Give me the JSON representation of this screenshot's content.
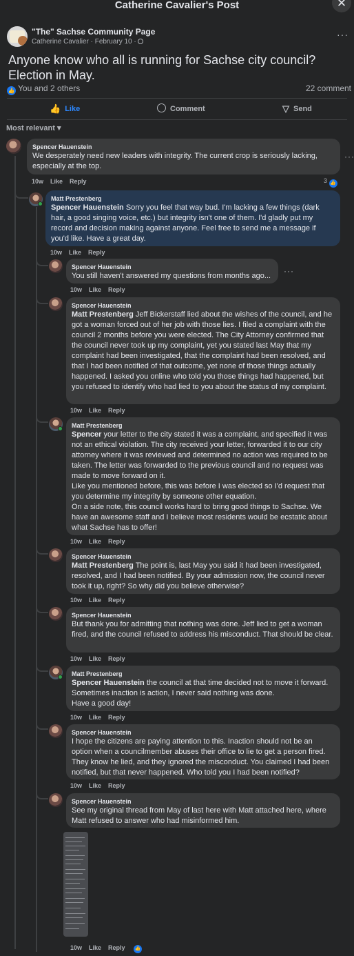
{
  "header": {
    "title": "Catherine Cavalier's Post",
    "close_symbol": "✕"
  },
  "post": {
    "page_name": "\"The\" Sachse Community Page",
    "author_line": "Catherine Cavalier · February 10 ·",
    "text": "Anyone know who all is running for Sachse city council? Election in May.",
    "reactions_text": "You and 2 others",
    "comment_count": "22 comment",
    "more": "···"
  },
  "actions": {
    "like": "Like",
    "comment": "Comment",
    "send": "Send"
  },
  "sort_label": "Most relevant ▾",
  "comments": [
    {
      "author": "Spencer Hauenstein",
      "tag": "",
      "text": "We desperately need new leaders with integrity. The current crop is seriously lacking, especially at the top.",
      "time": "10w",
      "like": "Like",
      "reply": "Reply",
      "reaction_count": "3"
    },
    {
      "author": "Matt Prestenberg",
      "tag": "Spencer Hauenstein",
      "text": " Sorry you feel that way bud. I'm lacking a few things (dark hair, a good singing voice, etc.) but integrity isn't one of them. I'd gladly put my record and decision making against anyone. Feel free to send me a message if you'd like. Have a great day.",
      "time": "10w",
      "like": "Like",
      "reply": "Reply"
    },
    {
      "author": "Spencer Hauenstein",
      "tag": "",
      "text": "You still haven't answered my questions from months ago...",
      "time": "10w",
      "like": "Like",
      "reply": "Reply"
    },
    {
      "author": "Spencer Hauenstein",
      "tag": "Matt Prestenberg",
      "text": " Jeff Bickerstaff lied about the wishes of the council, and he got a woman forced out of her job with those lies. I filed a complaint with the council 2 months before you were elected. The City Attorney confirmed that the council never took up my complaint, yet you stated last May that my complaint had been investigated, that the complaint had been resolved, and that I had been notified of that outcome, yet none of those things actually happened. I asked you online who told you those things had happened, but you refused to identify who had lied to you about the status of my complaint.",
      "time": "10w",
      "like": "Like",
      "reply": "Reply"
    },
    {
      "author": "Matt Prestenberg",
      "tag": "Spencer",
      "text": " your letter to the city stated it was a complaint, and specified it was not an ethical violation. The city received your letter, forwarded it to our city attorney where it was reviewed and determined no action was required to be taken. The letter was forwarded to the previous council and no request was made to move forward on it.",
      "text2": "Like you mentioned before, this was before I was elected so I'd request that you determine my integrity by someone other equation.",
      "text3": "On a side note, this council works hard to bring good things to Sachse. We have an awesome staff and I believe most residents would be ecstatic about what Sachse has to offer!",
      "time": "10w",
      "like": "Like",
      "reply": "Reply"
    },
    {
      "author": "Spencer Hauenstein",
      "tag": "Matt Prestenberg",
      "text": " The point is, last May you said it had been investigated, resolved, and I had been notified. By your admission now, the council never took it up, right? So why did you believe otherwise?",
      "time": "10w",
      "like": "Like",
      "reply": "Reply"
    },
    {
      "author": "Spencer Hauenstein",
      "tag": "",
      "text": "But thank you for admitting that nothing was done. Jeff lied to get a woman fired, and the council refused to address his misconduct. That should be clear.",
      "time": "10w",
      "like": "Like",
      "reply": "Reply"
    },
    {
      "author": "Matt Prestenberg",
      "tag": "Spencer Hauenstein",
      "text": " the council at that time decided not to move it forward. Sometimes inaction is action, I never said nothing was done.",
      "text2": "Have a good day!",
      "time": "10w",
      "like": "Like",
      "reply": "Reply"
    },
    {
      "author": "Spencer Hauenstein",
      "tag": "",
      "text": "I hope the citizens are paying attention to this. Inaction should not be an option when a councilmember abuses their office to lie to get a person fired. They know he lied, and they ignored the misconduct. You claimed I had been notified, but that never happened. Who told you I had been notified?",
      "time": "10w",
      "like": "Like",
      "reply": "Reply"
    },
    {
      "author": "Spencer Hauenstein",
      "tag": "",
      "text": "See my original thread from May of last here with Matt attached here, where Matt refused to answer who had misinformed him.",
      "time": "10w",
      "like": "Like",
      "reply": "Reply"
    }
  ],
  "colors": {
    "background": "#242526",
    "bubble": "#3a3b3c",
    "highlight_bubble": "#263951",
    "accent": "#2d88ff"
  }
}
